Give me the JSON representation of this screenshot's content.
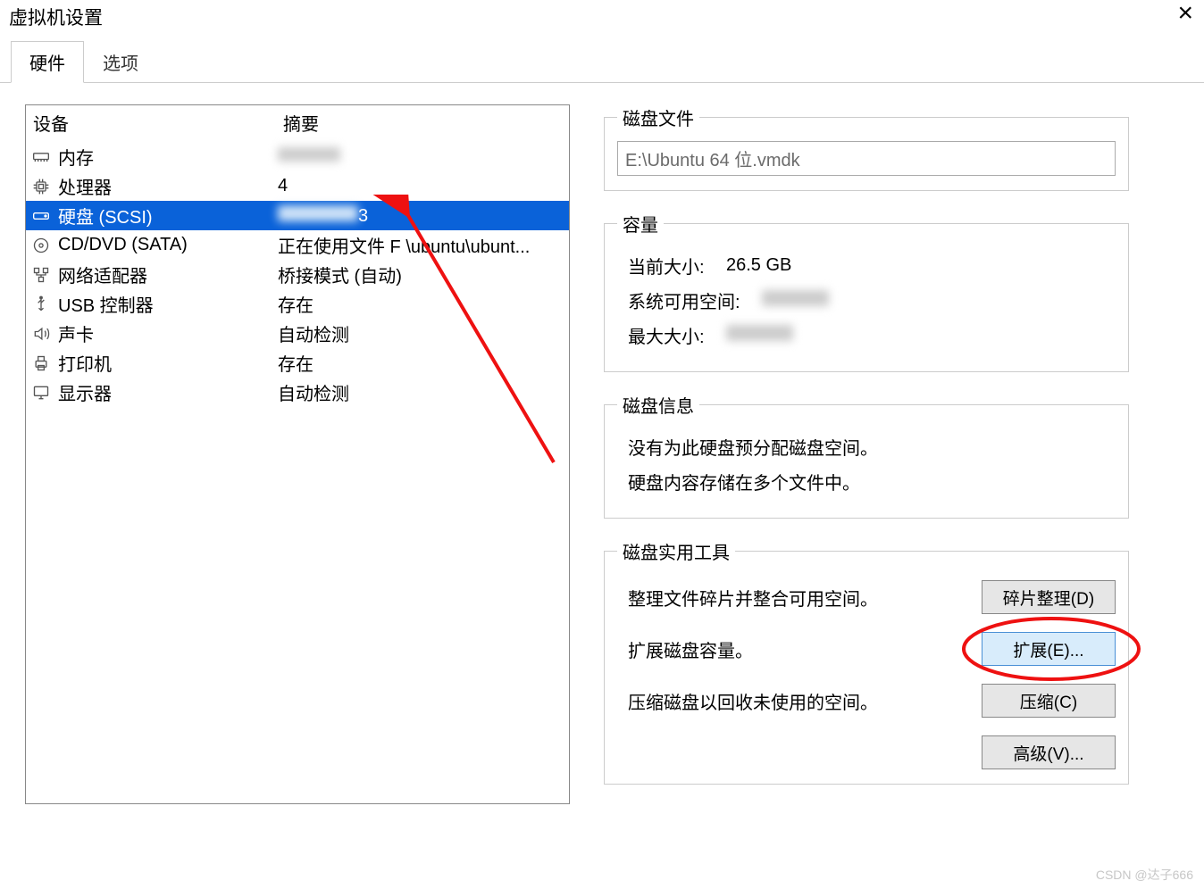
{
  "window": {
    "title": "虚拟机设置",
    "close": "×"
  },
  "tabs": {
    "hardware": "硬件",
    "options": "选项"
  },
  "table": {
    "header_device": "设备",
    "header_summary": "摘要"
  },
  "devices": [
    {
      "icon": "memory-icon",
      "label": "内存",
      "summary": "",
      "blurred": true
    },
    {
      "icon": "cpu-icon",
      "label": "处理器",
      "summary": "4"
    },
    {
      "icon": "disk-icon",
      "label": "硬盘 (SCSI)",
      "summary": "3",
      "selected": true,
      "partialBlur": true
    },
    {
      "icon": "cd-icon",
      "label": "CD/DVD (SATA)",
      "summary": "正在使用文件 F \\ubuntu\\ubunt..."
    },
    {
      "icon": "network-icon",
      "label": "网络适配器",
      "summary": "桥接模式 (自动)"
    },
    {
      "icon": "usb-icon",
      "label": "USB 控制器",
      "summary": "存在"
    },
    {
      "icon": "sound-icon",
      "label": "声卡",
      "summary": "自动检测"
    },
    {
      "icon": "printer-icon",
      "label": "打印机",
      "summary": "存在"
    },
    {
      "icon": "display-icon",
      "label": "显示器",
      "summary": "自动检测"
    }
  ],
  "panel": {
    "disk_file_legend": "磁盘文件",
    "disk_file_value": "E:\\Ubuntu 64 位.vmdk",
    "capacity_legend": "容量",
    "current_size_label": "当前大小:",
    "current_size_value": "26.5 GB",
    "sys_free_label": "系统可用空间:",
    "max_size_label": "最大大小:",
    "disk_info_legend": "磁盘信息",
    "disk_info_line1": "没有为此硬盘预分配磁盘空间。",
    "disk_info_line2": "硬盘内容存储在多个文件中。",
    "utilities_legend": "磁盘实用工具",
    "util_defrag_desc": "整理文件碎片并整合可用空间。",
    "util_defrag_btn": "碎片整理(D)",
    "util_expand_desc": "扩展磁盘容量。",
    "util_expand_btn": "扩展(E)...",
    "util_compact_desc": "压缩磁盘以回收未使用的空间。",
    "util_compact_btn": "压缩(C)",
    "advanced_btn": "高级(V)..."
  },
  "watermark": "CSDN @达子666"
}
